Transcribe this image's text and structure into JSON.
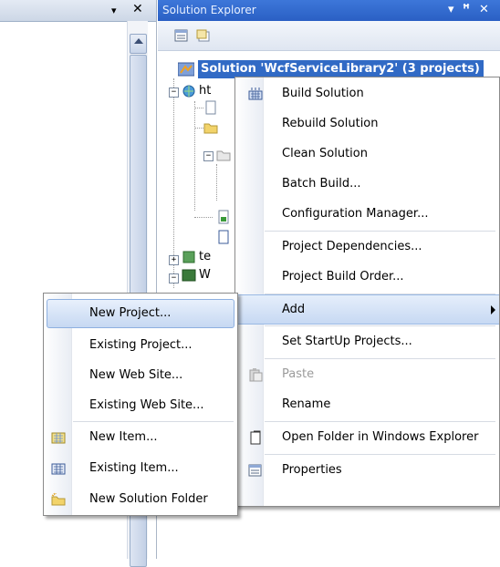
{
  "left_pane": {
    "chevron_glyph": "▾",
    "close_glyph": "✕"
  },
  "solution_explorer": {
    "title": "Solution Explorer",
    "pin_menu_glyph": "▾",
    "pin_glyph": "ꟸ",
    "close_glyph": "✕",
    "solution_label": "Solution 'WcfServiceLibrary2' (3 projects)",
    "tree_visible_fragments": [
      "ht",
      "te",
      "W"
    ]
  },
  "context_menu": {
    "items": [
      {
        "label": "Build Solution",
        "icon": "build-solution-icon"
      },
      {
        "label": "Rebuild Solution"
      },
      {
        "label": "Clean Solution"
      },
      {
        "label": "Batch Build..."
      },
      {
        "label": "Configuration Manager..."
      },
      {
        "label": "Project Dependencies..."
      },
      {
        "label": "Project Build Order..."
      },
      {
        "label": "Add",
        "has_submenu": true
      },
      {
        "label": "Set StartUp Projects..."
      },
      {
        "label": "Paste",
        "icon": "paste-icon",
        "disabled": true
      },
      {
        "label": "Rename"
      },
      {
        "label": "Open Folder in Windows Explorer",
        "icon": "open-folder-icon"
      },
      {
        "label": "Properties",
        "icon": "properties-icon"
      }
    ]
  },
  "add_submenu": {
    "items": [
      {
        "label": "New Project..."
      },
      {
        "label": "Existing Project..."
      },
      {
        "label": "New Web Site..."
      },
      {
        "label": "Existing Web Site..."
      },
      {
        "label": "New Item...",
        "icon": "new-item-icon"
      },
      {
        "label": "Existing Item...",
        "icon": "existing-item-icon"
      },
      {
        "label": "New Solution Folder",
        "icon": "new-solution-folder-icon"
      }
    ]
  },
  "colors": {
    "title_bar": "#2f66cc",
    "selection": "#316ac5",
    "menu_highlight": "#c7d9f3"
  }
}
